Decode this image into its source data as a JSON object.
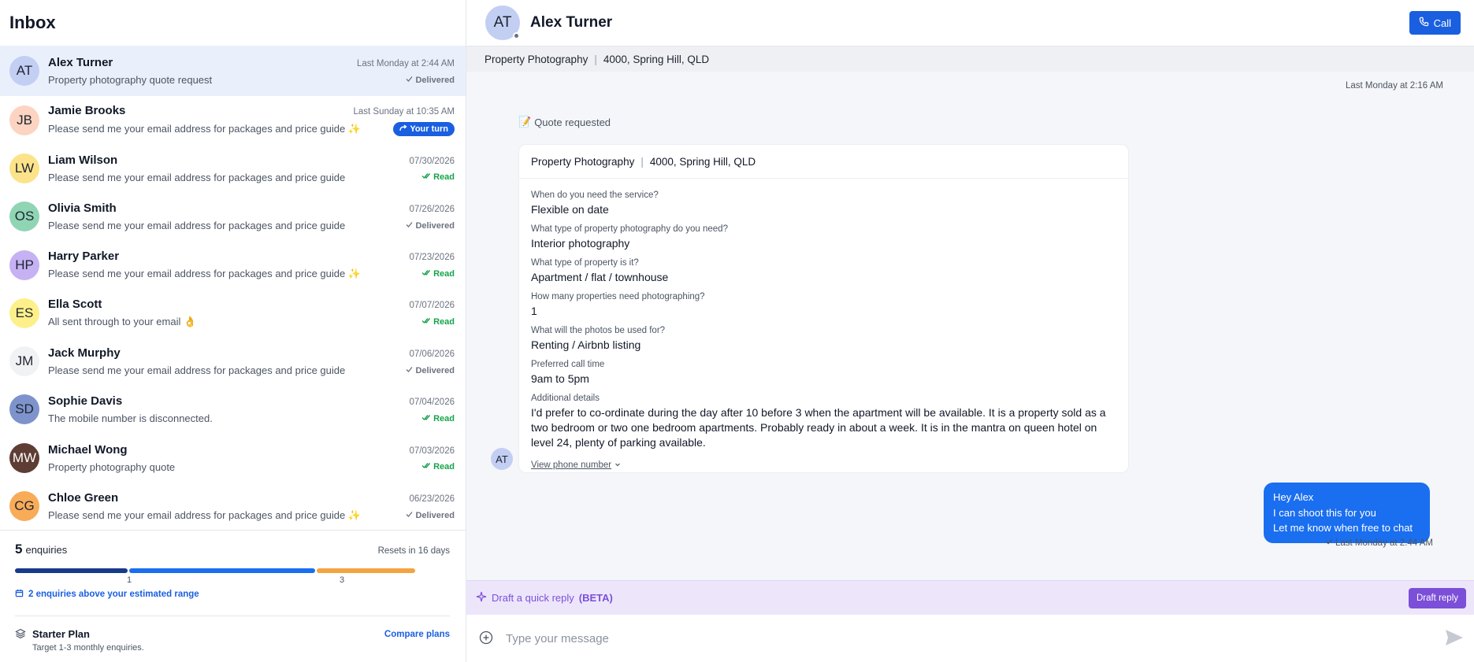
{
  "inbox": {
    "title": "Inbox",
    "conversations": [
      {
        "initials": "AT",
        "avatar_color": "#c3cef3",
        "name": "Alex Turner",
        "time": "Last Monday at 2:44 AM",
        "snippet": "Property photography quote request",
        "status": "Delivered",
        "status_type": "delivered"
      },
      {
        "initials": "JB",
        "avatar_color": "#fcd4c1",
        "name": "Jamie Brooks",
        "time": "Last Sunday at 10:35 AM",
        "snippet": "Please send me your email address for packages and price guide ✨",
        "status": "Your turn",
        "status_type": "yourturn"
      },
      {
        "initials": "LW",
        "avatar_color": "#fce38a",
        "name": "Liam Wilson",
        "time": "07/30/2026",
        "snippet": "Please send me your email address for packages and price guide",
        "status": "Read",
        "status_type": "read"
      },
      {
        "initials": "OS",
        "avatar_color": "#8fd5b4",
        "name": "Olivia Smith",
        "time": "07/26/2026",
        "snippet": "Please send me your email address for packages and price guide",
        "status": "Delivered",
        "status_type": "delivered"
      },
      {
        "initials": "HP",
        "avatar_color": "#c6b1f3",
        "name": "Harry Parker",
        "time": "07/23/2026",
        "snippet": "Please send me your email address for packages and price guide ✨",
        "status": "Read",
        "status_type": "read"
      },
      {
        "initials": "ES",
        "avatar_color": "#fdf08a",
        "name": "Ella Scott",
        "time": "07/07/2026",
        "snippet": "All sent through to your email 👌",
        "status": "Read",
        "status_type": "read"
      },
      {
        "initials": "JM",
        "avatar_color": "#f1f2f4",
        "name": "Jack Murphy",
        "time": "07/06/2026",
        "snippet": "Please send me your email address for packages and price guide",
        "status": "Delivered",
        "status_type": "delivered"
      },
      {
        "initials": "SD",
        "avatar_color": "#7e93cc",
        "name": "Sophie Davis",
        "time": "07/04/2026",
        "snippet": "The mobile number is disconnected.",
        "status": "Read",
        "status_type": "read"
      },
      {
        "initials": "MW",
        "avatar_color": "#5d3d34",
        "name": "Michael Wong",
        "time": "07/03/2026",
        "snippet": "Property photography quote",
        "status": "Read",
        "status_type": "read"
      },
      {
        "initials": "CG",
        "avatar_color": "#f8ac58",
        "name": "Chloe Green",
        "time": "06/23/2026",
        "snippet": "Please send me your email address for packages and price guide ✨",
        "status": "Delivered",
        "status_type": "delivered"
      }
    ]
  },
  "usage": {
    "count": "5",
    "count_label": "enquiries",
    "reset_text": "Resets in 16 days",
    "tick_1": "1",
    "tick_3": "3",
    "segment_colors": [
      "#173a8a",
      "#1a6ef0",
      "#f4a340"
    ],
    "above_range_text": "2 enquiries above your estimated range"
  },
  "plan": {
    "name": "Starter Plan",
    "desc": "Target 1-3 monthly enquiries.",
    "compare_label": "Compare plans"
  },
  "chat": {
    "contact_initials": "AT",
    "contact_name": "Alex Turner",
    "call_label": "Call",
    "service": "Property Photography",
    "location": "4000, Spring Hill, QLD",
    "timestamp_top": "Last Monday at 2:16 AM",
    "quote_label": "Quote requested",
    "card_service": "Property Photography",
    "card_location": "4000, Spring Hill, QLD",
    "qa": [
      {
        "q": "When do you need the service?",
        "a": "Flexible on date"
      },
      {
        "q": "What type of property photography do you need?",
        "a": "Interior photography"
      },
      {
        "q": "What type of property is it?",
        "a": "Apartment / flat / townhouse"
      },
      {
        "q": "How many properties need photographing?",
        "a": "1"
      },
      {
        "q": "What will the photos be used for?",
        "a": "Renting / Airbnb listing"
      },
      {
        "q": "Preferred call time",
        "a": "9am to 5pm"
      },
      {
        "q": "Additional details",
        "a": "I'd prefer to co-ordinate during the day after 10 before 3 when the apartment will be available. It is a property sold as a two bedroom or two one bedroom apartments. Probably ready in about a week. It is in the mantra on queen hotel on level 24, plenty of parking available."
      }
    ],
    "view_phone": "View phone number",
    "reply_lines": [
      "Hey Alex",
      "I can shoot this for you",
      "Let me know when free to chat"
    ],
    "reply_time": "Last Monday at 2:44 AM",
    "draft_text": "Draft a quick reply",
    "draft_beta": "(BETA)",
    "draft_button": "Draft reply",
    "composer_placeholder": "Type your message"
  }
}
